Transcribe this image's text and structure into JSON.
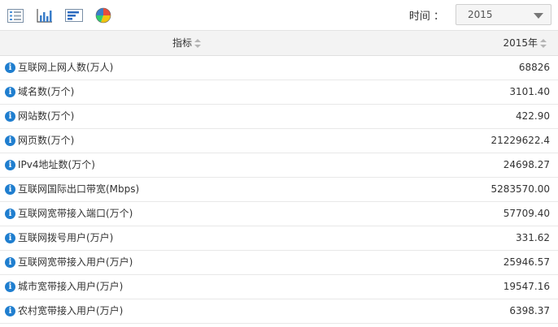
{
  "toolbar": {
    "icons": [
      "table-view-icon",
      "bar-chart-icon",
      "horizontal-bar-chart-icon",
      "pie-chart-icon"
    ],
    "time_label": "时间 ：",
    "time_value": "2015"
  },
  "table": {
    "header_indicator": "指标",
    "header_year": "2015年",
    "rows": [
      {
        "name": "互联网上网人数(万人)",
        "value": "68826"
      },
      {
        "name": "域名数(万个)",
        "value": "3101.40"
      },
      {
        "name": "网站数(万个)",
        "value": "422.90"
      },
      {
        "name": "网页数(万个)",
        "value": "21229622.4"
      },
      {
        "name": "IPv4地址数(万个)",
        "value": "24698.27"
      },
      {
        "name": "互联网国际出口带宽(Mbps)",
        "value": "5283570.00"
      },
      {
        "name": "互联网宽带接入端口(万个)",
        "value": "57709.40"
      },
      {
        "name": "互联网拨号用户(万户)",
        "value": "331.62"
      },
      {
        "name": "互联网宽带接入用户(万户)",
        "value": "25946.57"
      },
      {
        "name": "城市宽带接入用户(万户)",
        "value": "19547.16"
      },
      {
        "name": "农村宽带接入用户(万户)",
        "value": "6398.37"
      }
    ]
  },
  "colors": {
    "info_icon": "#1f7ecf",
    "header_bg": "#f3f3f3"
  }
}
